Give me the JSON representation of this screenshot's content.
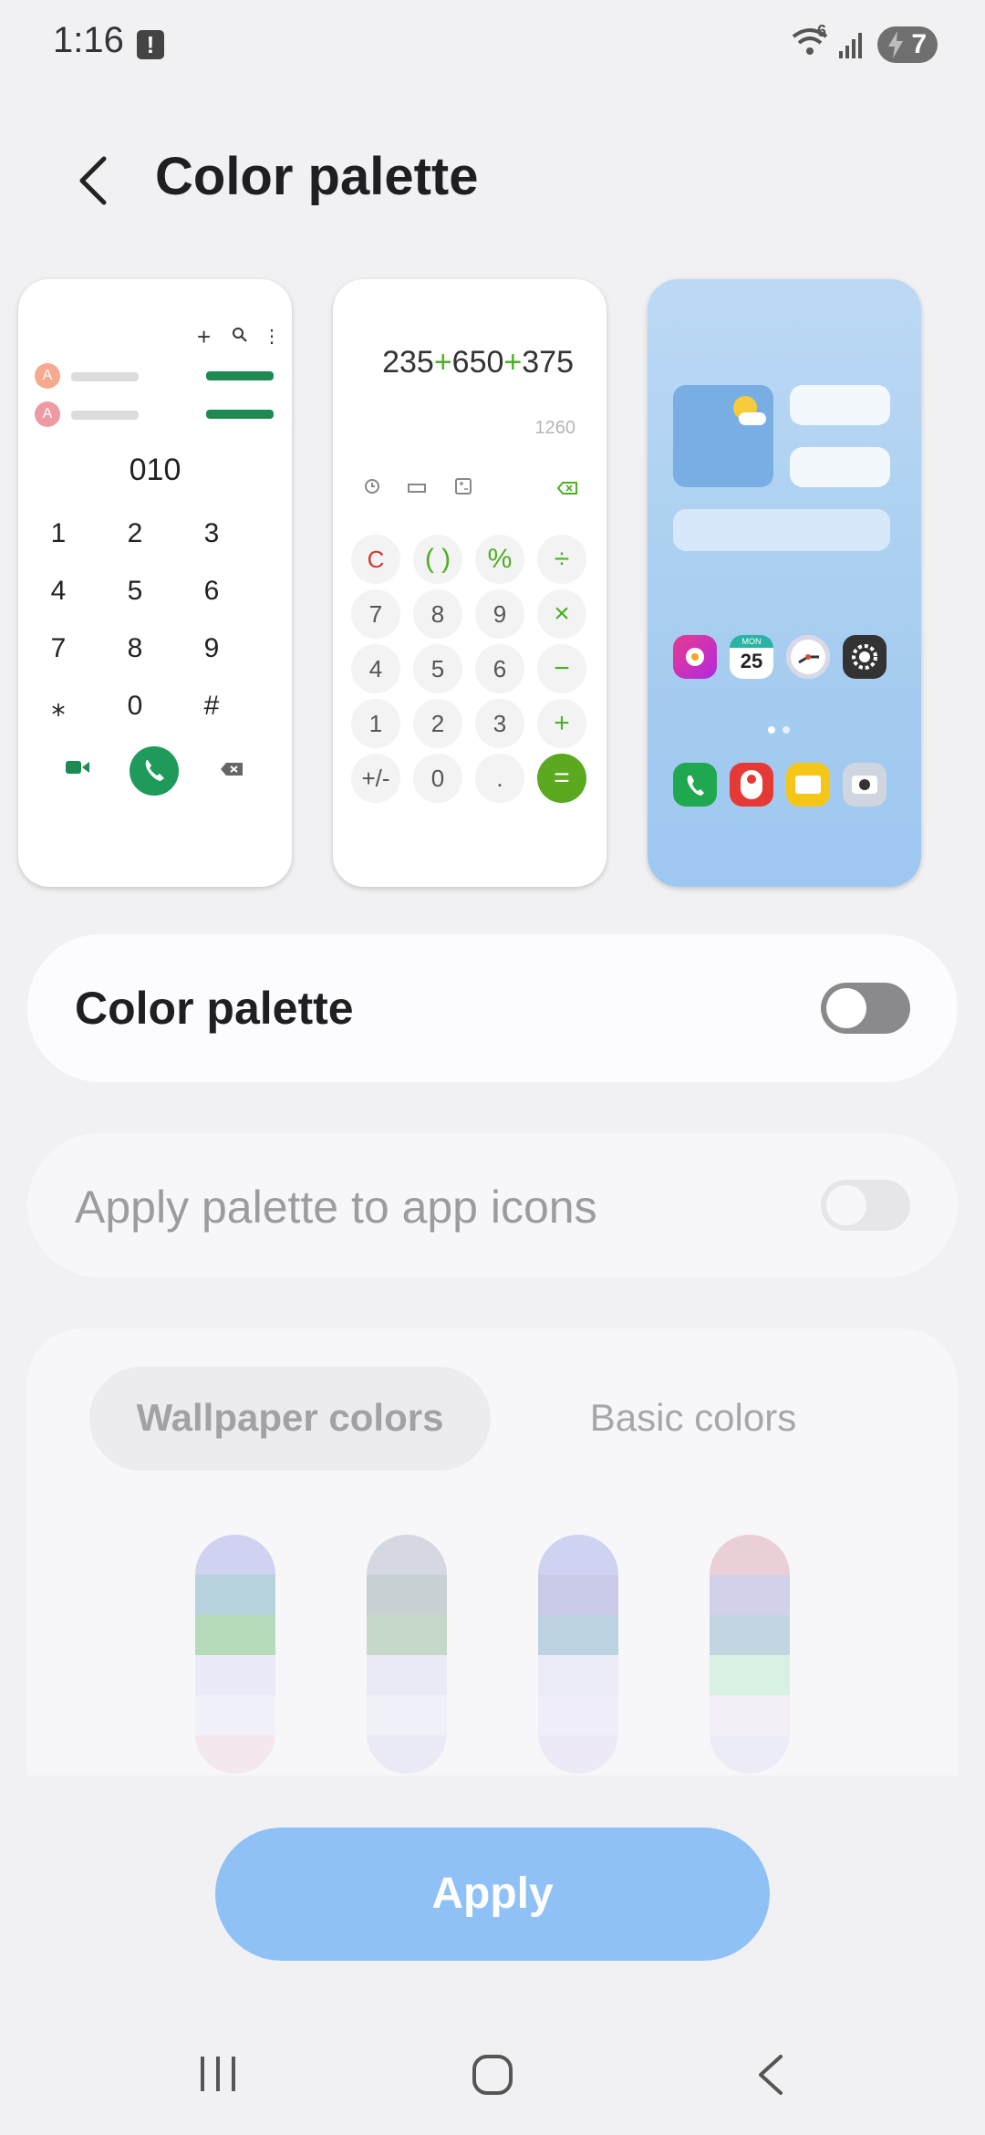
{
  "status": {
    "time": "1:16",
    "alert_icon": "alert-notification-icon",
    "battery": "7",
    "signal_badge": "6"
  },
  "header": {
    "back_icon": "back-arrow-icon",
    "title": "Color palette"
  },
  "preview": {
    "dialer": {
      "number": "010",
      "avatar_letter": "A",
      "keys": [
        "1",
        "2",
        "3",
        "4",
        "5",
        "6",
        "7",
        "8",
        "9",
        "⁎",
        "0",
        "#"
      ],
      "accent": "#1e8a52"
    },
    "calculator": {
      "expression_parts": [
        "235",
        "+",
        "650",
        "+",
        "375"
      ],
      "result": "1260",
      "keys": [
        "C",
        "( )",
        "%",
        "÷",
        "7",
        "8",
        "9",
        "×",
        "4",
        "5",
        "6",
        "−",
        "1",
        "2",
        "3",
        "+",
        "+/-",
        "0",
        ".",
        "="
      ],
      "accent": "#5aa91f"
    },
    "home": {
      "calendar_day": "MON",
      "calendar_date": "25"
    }
  },
  "color_palette_toggle": {
    "label": "Color palette",
    "state": "off"
  },
  "apply_icons_toggle": {
    "label": "Apply palette to app icons",
    "state": "off",
    "disabled": true
  },
  "tabs": [
    {
      "label": "Wallpaper colors",
      "selected": true
    },
    {
      "label": "Basic colors",
      "selected": false
    }
  ],
  "palettes": [
    [
      "#cfd3f1",
      "#b5d2dd",
      "#b6dbba",
      "#e9ecf8",
      "#eff0f8",
      "#f3e7f0"
    ],
    [
      "#d5d7e2",
      "#c7d0d2",
      "#c6d8c6",
      "#e8eaf6",
      "#eff0f8",
      "#eaeaf6"
    ],
    [
      "#cdd3f1",
      "#c9cbe9",
      "#bcd4e2",
      "#ebecf8",
      "#f0eef8",
      "#ede9f6"
    ],
    [
      "#ead0d6",
      "#d2d1ec",
      "#c2d6e2",
      "#d8f1e2",
      "#f4eef6",
      "#ececf8"
    ]
  ],
  "apply_button": "Apply",
  "nav": {
    "recents_icon": "recents-icon",
    "home_icon": "home-icon",
    "back_icon": "nav-back-icon"
  }
}
